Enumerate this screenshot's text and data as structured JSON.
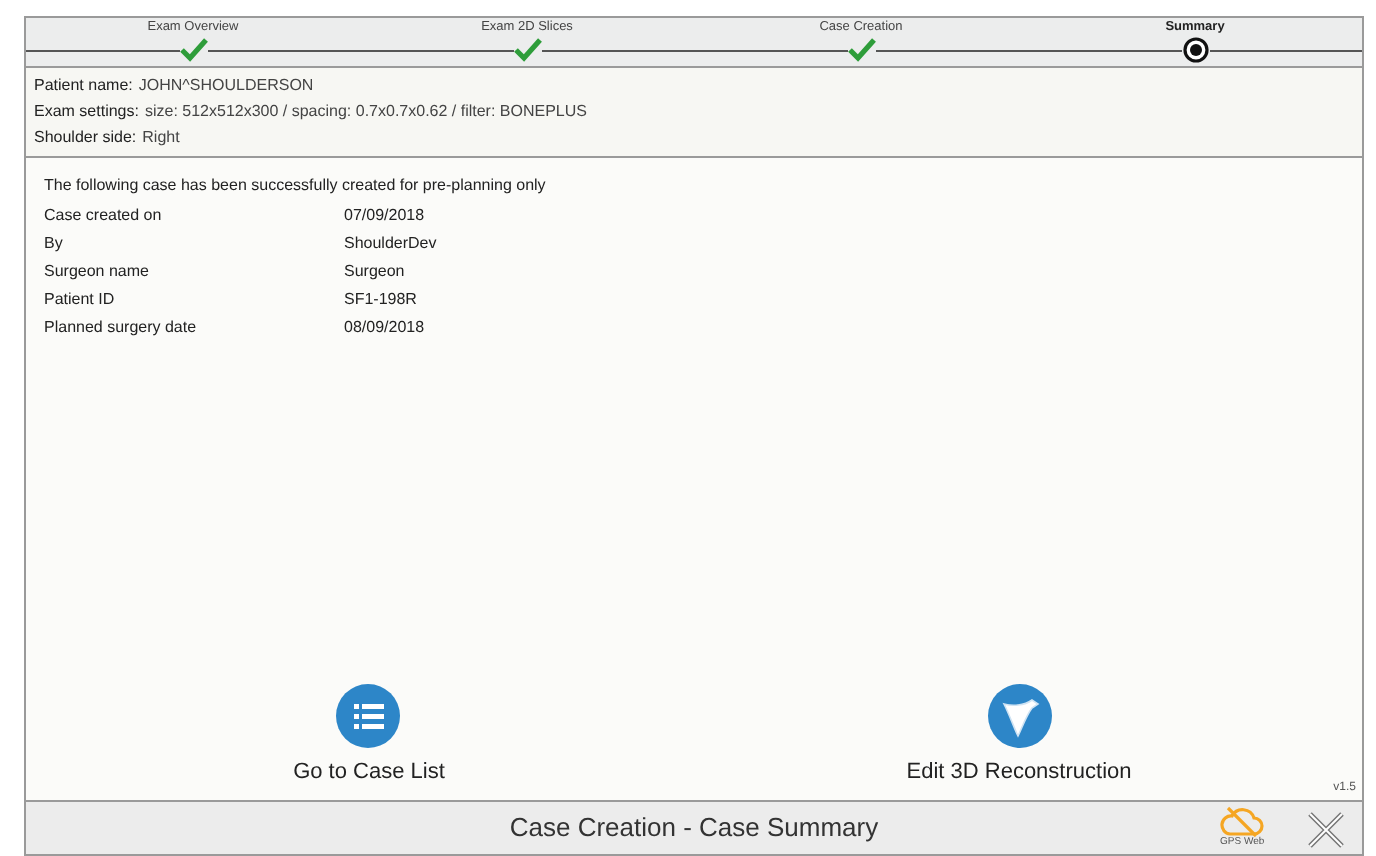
{
  "steps": [
    {
      "label": "Exam Overview",
      "completed": true,
      "selected": false
    },
    {
      "label": "Exam 2D Slices",
      "completed": true,
      "selected": false
    },
    {
      "label": "Case Creation",
      "completed": true,
      "selected": false
    },
    {
      "label": "Summary",
      "completed": false,
      "selected": true
    }
  ],
  "patient_info": [
    {
      "label": "Patient name:",
      "value": "JOHN^SHOULDERSON"
    },
    {
      "label": "Exam settings:",
      "value": "size: 512x512x300 / spacing: 0.7x0.7x0.62 / filter: BONEPLUS"
    },
    {
      "label": "Shoulder side:",
      "value": "Right"
    }
  ],
  "summary": {
    "message": "The following case has been successfully created for pre-planning only",
    "rows": [
      {
        "label": "Case created on",
        "value": "07/09/2018"
      },
      {
        "label": "By",
        "value": "ShoulderDev"
      },
      {
        "label": "Surgeon name",
        "value": "Surgeon"
      },
      {
        "label": "Patient ID",
        "value": "SF1-198R"
      },
      {
        "label": "Planned surgery date",
        "value": "08/09/2018"
      }
    ]
  },
  "actions": [
    {
      "kind": "list",
      "label": "Go to Case List"
    },
    {
      "kind": "bone",
      "label": "Edit 3D Reconstruction"
    }
  ],
  "version": "v1.5",
  "bottom_bar": {
    "title": "Case Creation - Case Summary",
    "gps_label": "GPS Web"
  }
}
